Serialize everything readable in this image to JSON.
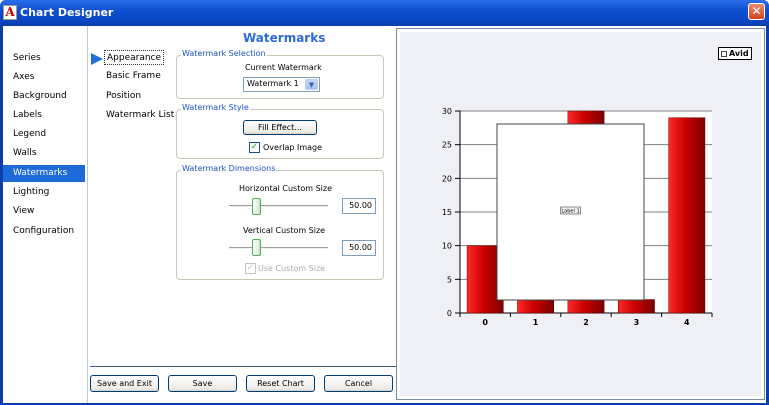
{
  "window": {
    "title": "Chart Designer",
    "app_icon": "A",
    "close_glyph": "✕"
  },
  "nav": {
    "items": [
      "Series",
      "Axes",
      "Background",
      "Labels",
      "Legend",
      "Walls",
      "Watermarks",
      "Lighting",
      "View",
      "Configuration"
    ],
    "active": "Watermarks"
  },
  "subnav": {
    "items": [
      "Appearance",
      "Basic Frame",
      "Position",
      "Watermark List"
    ],
    "active": "Appearance"
  },
  "panel": {
    "title": "Watermarks",
    "selection": {
      "group_label": "Watermark Selection",
      "current_label": "Current Watermark",
      "current_value": "Watermark 1"
    },
    "style": {
      "group_label": "Watermark Style",
      "fill_button": "Fill Effect...",
      "overlap_label": "Overlap Image",
      "overlap_checked": true
    },
    "dimensions": {
      "group_label": "Watermark Dimensions",
      "horizontal_label": "Horizontal Custom Size",
      "horizontal_value": "50.00",
      "horizontal_level": 0.5,
      "vertical_label": "Vertical Custom Size",
      "vertical_value": "50.00",
      "vertical_level": 0.5,
      "use_custom_label": "Use Custom Size",
      "use_custom_checked": true,
      "use_custom_enabled": false
    }
  },
  "buttons": {
    "save_exit": "Save and Exit",
    "save": "Save",
    "reset": "Reset Chart",
    "cancel": "Cancel"
  },
  "preview": {
    "legend_entry": "Avid",
    "watermark_label": "Label 1"
  },
  "colors": {
    "bar": "#cc0000",
    "nav_active": "#1e6ad8",
    "title_blue": "#2b6bd6"
  },
  "chart_data": {
    "type": "bar",
    "categories": [
      "0",
      "1",
      "2",
      "3",
      "4"
    ],
    "series": [
      {
        "name": "Avid",
        "values": [
          10,
          2,
          30,
          2,
          29
        ]
      }
    ],
    "ylim": [
      0,
      30
    ],
    "yticks": [
      "0",
      "5",
      "10",
      "15",
      "20",
      "25",
      "30"
    ],
    "grid": true,
    "legend": "top-right"
  }
}
